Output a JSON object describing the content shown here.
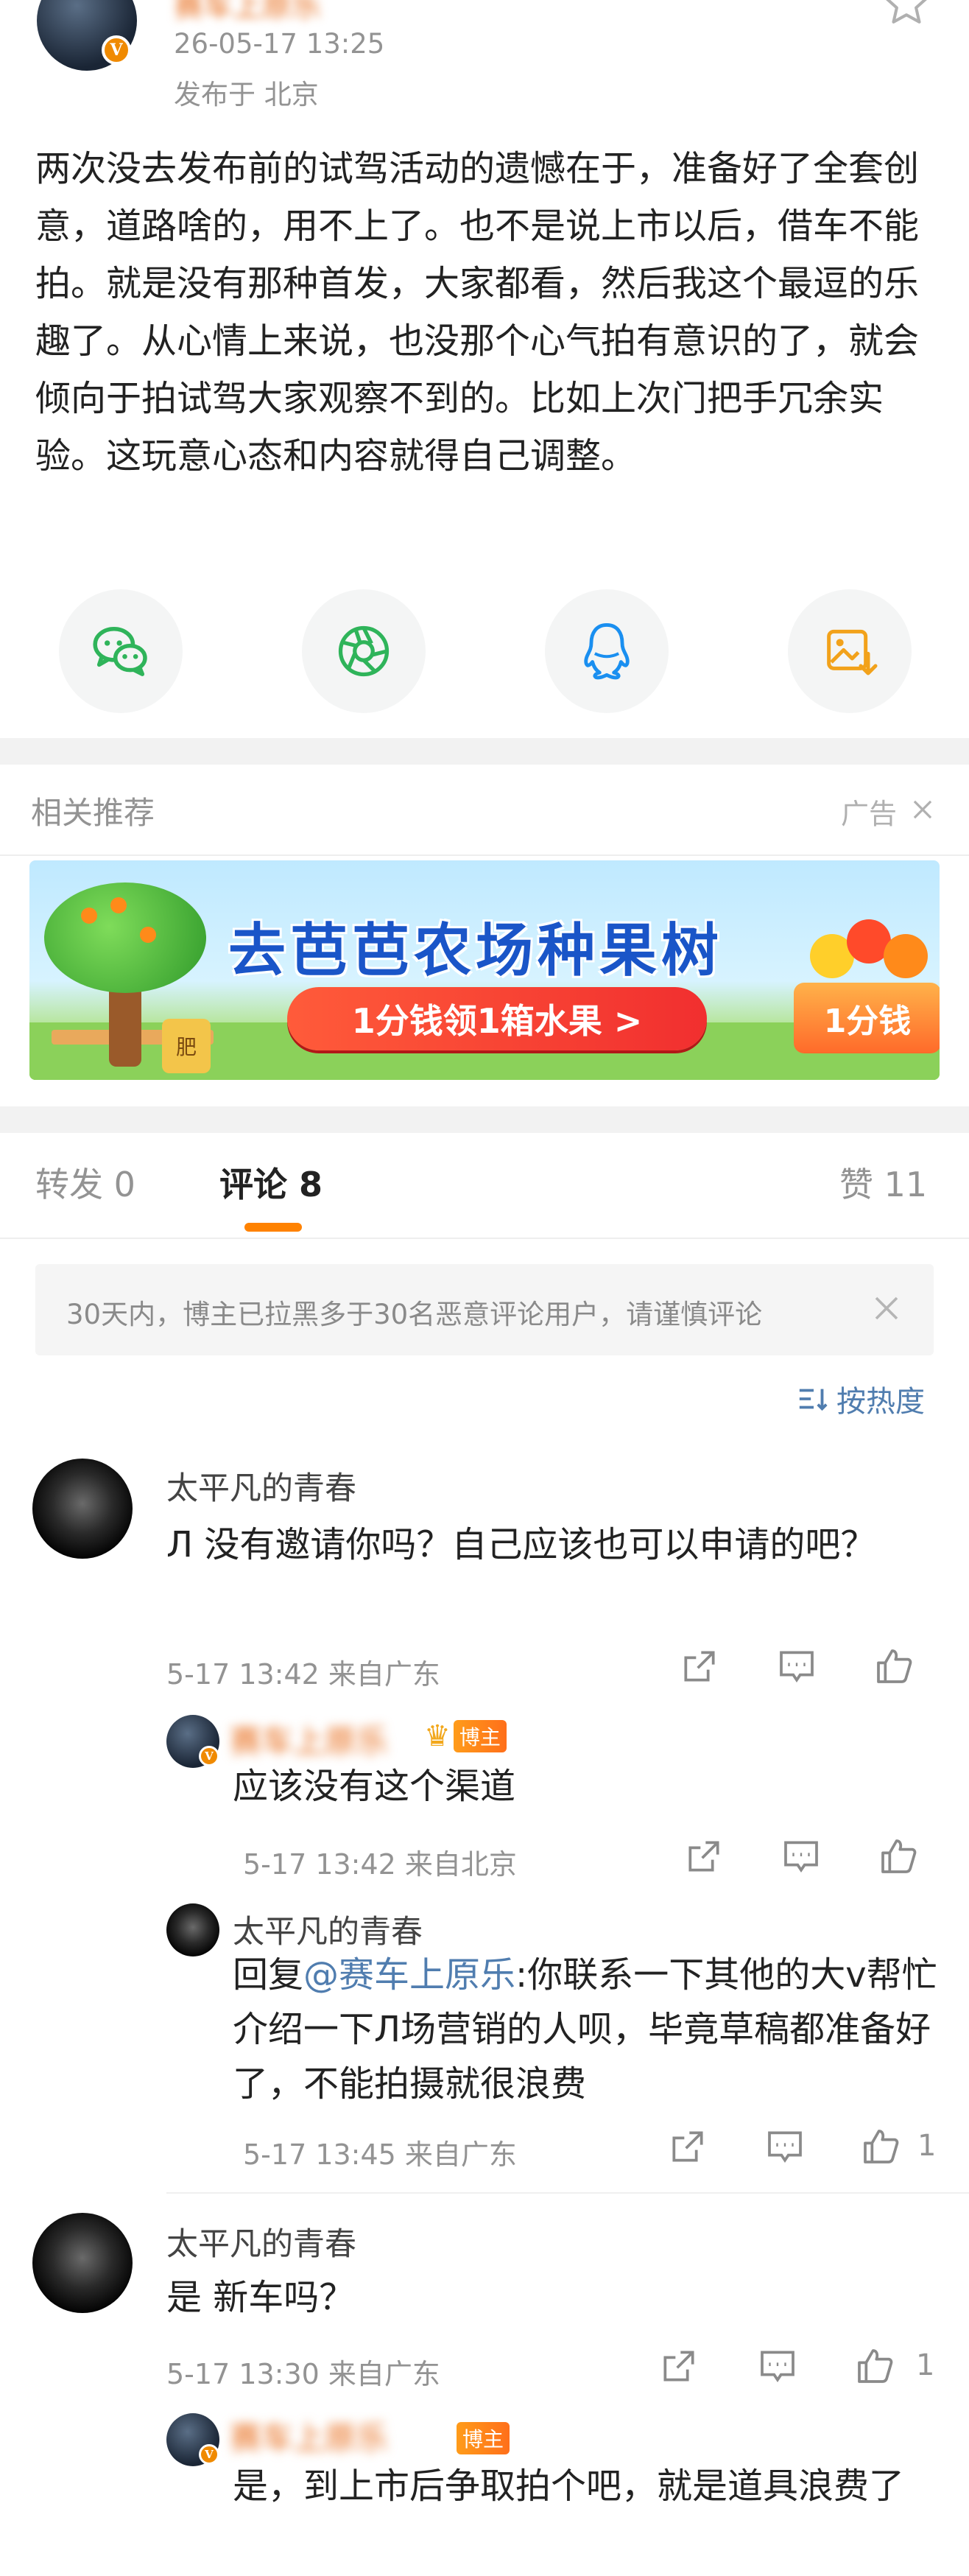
{
  "post": {
    "author_name": "赛车上原乐",
    "time": "26-05-17 13:25",
    "location": "发布于 北京",
    "text": "两次没去发布前的试驾活动的遗憾在于，准备好了全套创意，道路啥的，用不上了。也不是说上市以后，借车不能拍。就是没有那种首发，大家都看，然后我这个最逗的乐趣了。从心情上来说，也没那个心气拍有意识的了，就会倾向于拍试驾大家观察不到的。比如上次门把手冗余实验。这玩意心态和内容就得自己调整。"
  },
  "share_icons": [
    "wechat-icon",
    "moments-icon",
    "qq-icon",
    "save-image-icon"
  ],
  "recommend": {
    "title": "相关推荐",
    "ad_label": "广告",
    "banner_title": "去芭芭农场种果树",
    "banner_button": "1分钱领1箱水果 >",
    "banner_tag": "1分钱",
    "banner_fertilizer": "肥"
  },
  "tabs": {
    "repost": "转发 0",
    "comments": "评论 8",
    "likes": "赞 11"
  },
  "notice": "30天内，博主已拉黑多于30名恶意评论用户，请谨慎评论",
  "sort_label": "按热度",
  "owner_badge": "博主",
  "comments": [
    {
      "name": "太平凡的青春",
      "text": "Л 没有邀请你吗？自己应该也可以申请的吧？",
      "meta": "5-17 13:42 来自广东",
      "likes": "",
      "replies": [
        {
          "name": "赛车上原乐",
          "text": "应该没有这个渠道",
          "meta": "5-17 13:42 来自北京",
          "likes": ""
        },
        {
          "name": "太平凡的青春",
          "reply_prefix": "回复",
          "mention": "@赛车上原乐",
          "text": ":你联系一下其他的大v帮忙介绍一下Л场营销的人呗，毕竟草稿都准备好了，不能拍摄就很浪费",
          "meta": "5-17 13:45 来自广东",
          "likes": "1"
        }
      ]
    },
    {
      "name": "太平凡的青春",
      "text": "是 新车吗？",
      "meta": "5-17 13:30 来自广东",
      "likes": "1",
      "replies": [
        {
          "name": "赛车上原乐",
          "text": "是，到上市后争取拍个吧，就是道具浪费了",
          "meta": "",
          "likes": ""
        }
      ]
    }
  ]
}
